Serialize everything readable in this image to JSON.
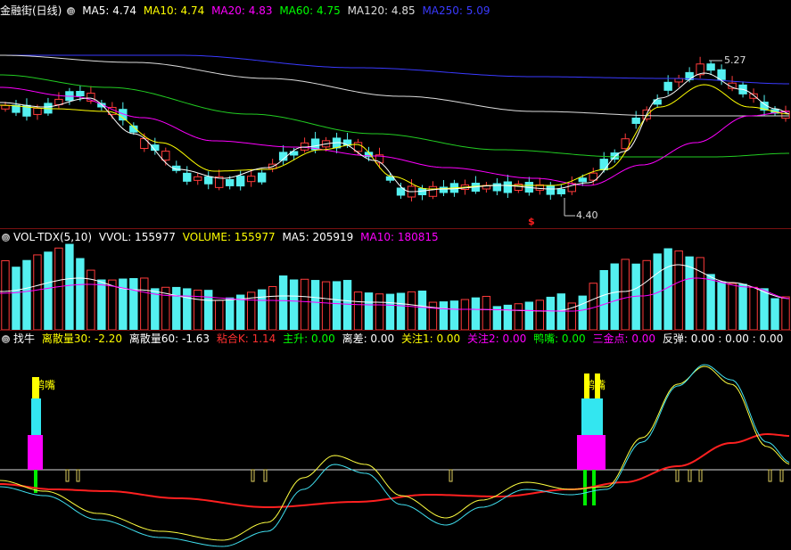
{
  "price": {
    "title": "金融街(日线)",
    "ma": [
      {
        "label": "MA5: 4.74",
        "color": "#ffffff"
      },
      {
        "label": "MA10: 4.74",
        "color": "#ffff00"
      },
      {
        "label": "MA20: 4.83",
        "color": "#ff00ff"
      },
      {
        "label": "MA60: 4.75",
        "color": "#00ff00"
      },
      {
        "label": "MA120: 4.85",
        "color": "#e0e0e0"
      },
      {
        "label": "MA250: 5.09",
        "color": "#3030ff"
      }
    ],
    "high_marker": "5.27",
    "low_marker": "4.40",
    "signal_glyph": "$"
  },
  "volume": {
    "title": "VOL-TDX(5,10)",
    "fields": [
      {
        "label": "VVOL: 155977",
        "color": "#ffffff"
      },
      {
        "label": "VOLUME: 155977",
        "color": "#ffff00"
      },
      {
        "label": "MA5: 205919",
        "color": "#ffffff"
      },
      {
        "label": "MA10: 180815",
        "color": "#ff00ff"
      }
    ]
  },
  "indicator": {
    "title": "找牛",
    "fields": [
      {
        "label": "离散量30: -2.20",
        "color": "#ffff00"
      },
      {
        "label": "离散量60: -1.63",
        "color": "#ffffff"
      },
      {
        "label": "粘合K: 1.14",
        "color": "#ff3030"
      },
      {
        "label": "主升: 0.00",
        "color": "#00ff00"
      },
      {
        "label": "离差: 0.00",
        "color": "#ffffff"
      },
      {
        "label": "关注1: 0.00",
        "color": "#ffff00"
      },
      {
        "label": "关注2: 0.00",
        "color": "#ff00ff"
      },
      {
        "label": "鸭嘴: 0.00",
        "color": "#00ff00"
      },
      {
        "label": "三金点: 0.00",
        "color": "#ff00ff"
      },
      {
        "label": "反弹: 0.00 : 0.00 : 0.00",
        "color": "#ffffff"
      }
    ],
    "duck_label": "鸭嘴"
  }
}
